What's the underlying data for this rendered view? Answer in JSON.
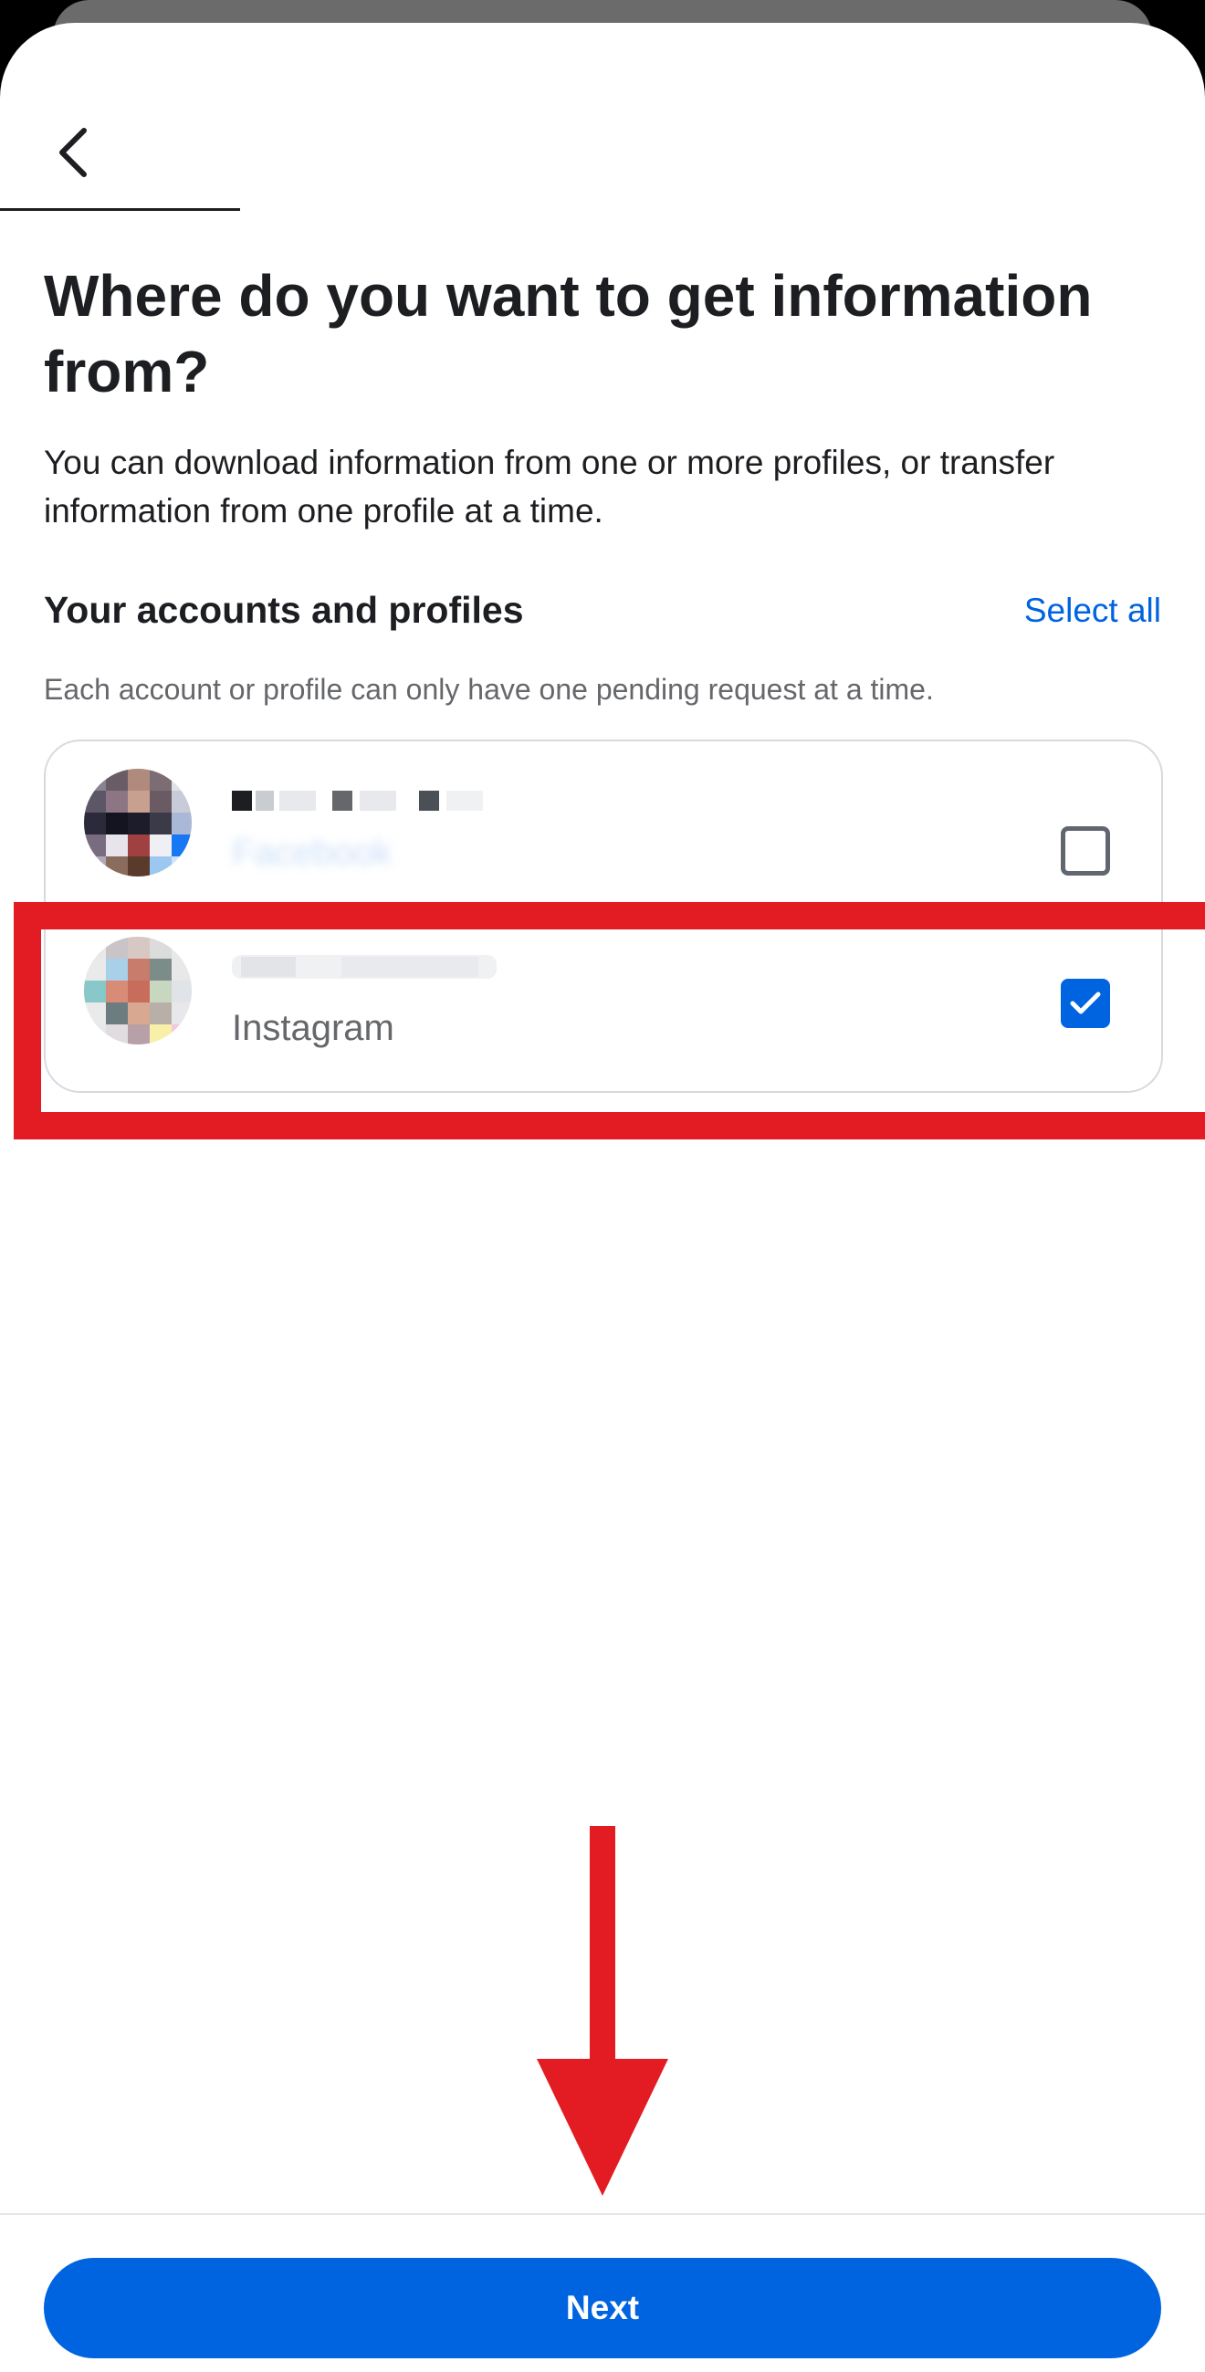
{
  "header": {
    "back_icon": "chevron-left-icon"
  },
  "content": {
    "title": "Where do you want to get information from?",
    "description": "You can download information from one or more profiles, or transfer information from one profile at a time."
  },
  "accounts_section": {
    "title": "Your accounts and profiles",
    "select_all_label": "Select all",
    "note": "Each account or profile can only have one pending request at a time."
  },
  "accounts": [
    {
      "name": "",
      "platform": "Facebook",
      "checked": false
    },
    {
      "name": "",
      "platform": "Instagram",
      "checked": true
    }
  ],
  "footer": {
    "next_label": "Next"
  },
  "colors": {
    "accent": "#0064e0",
    "annotation_red": "#e31b23",
    "text_primary": "#1c1e21",
    "text_secondary": "#65676b"
  }
}
